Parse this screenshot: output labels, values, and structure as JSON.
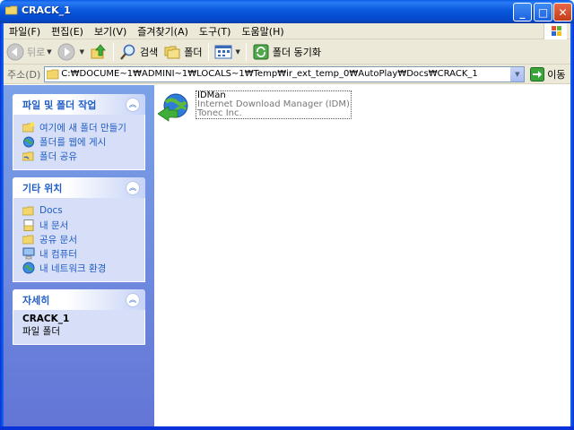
{
  "window": {
    "title": "CRACK_1",
    "controls": {
      "minimize": "_",
      "maximize": "□",
      "close": "✕"
    }
  },
  "menu": [
    "파일(F)",
    "편집(E)",
    "보기(V)",
    "즐겨찾기(A)",
    "도구(T)",
    "도움말(H)"
  ],
  "toolbar": {
    "back_label": "뒤로",
    "search_label": "검색",
    "folders_label": "폴더",
    "sync_label": "폴더 동기화"
  },
  "address": {
    "label": "주소(D)",
    "path": "C:₩DOCUME~1₩ADMINI~1₩LOCALS~1₩Temp₩ir_ext_temp_0₩AutoPlay₩Docs₩CRACK_1",
    "go_label": "이동"
  },
  "task_pane": {
    "file_tasks": {
      "title": "파일 및 폴더 작업",
      "items": [
        {
          "label": "여기에 새 폴더 만들기",
          "icon": "new-folder-icon"
        },
        {
          "label": "폴더를 웹에 게시",
          "icon": "publish-web-icon"
        },
        {
          "label": "폴더 공유",
          "icon": "share-folder-icon"
        }
      ]
    },
    "other_places": {
      "title": "기타 위치",
      "items": [
        {
          "label": "Docs",
          "icon": "folder-icon"
        },
        {
          "label": "내 문서",
          "icon": "my-documents-icon"
        },
        {
          "label": "공유 문서",
          "icon": "shared-documents-icon"
        },
        {
          "label": "내 컴퓨터",
          "icon": "my-computer-icon"
        },
        {
          "label": "내 네트워크 환경",
          "icon": "network-places-icon"
        }
      ]
    },
    "details": {
      "title": "자세히",
      "name": "CRACK_1",
      "type": "파일 폴더"
    }
  },
  "files": [
    {
      "name": "IDMan",
      "description": "Internet Download Manager (IDM)",
      "company": "Tonec Inc.",
      "icon": "idm-app-icon"
    }
  ]
}
